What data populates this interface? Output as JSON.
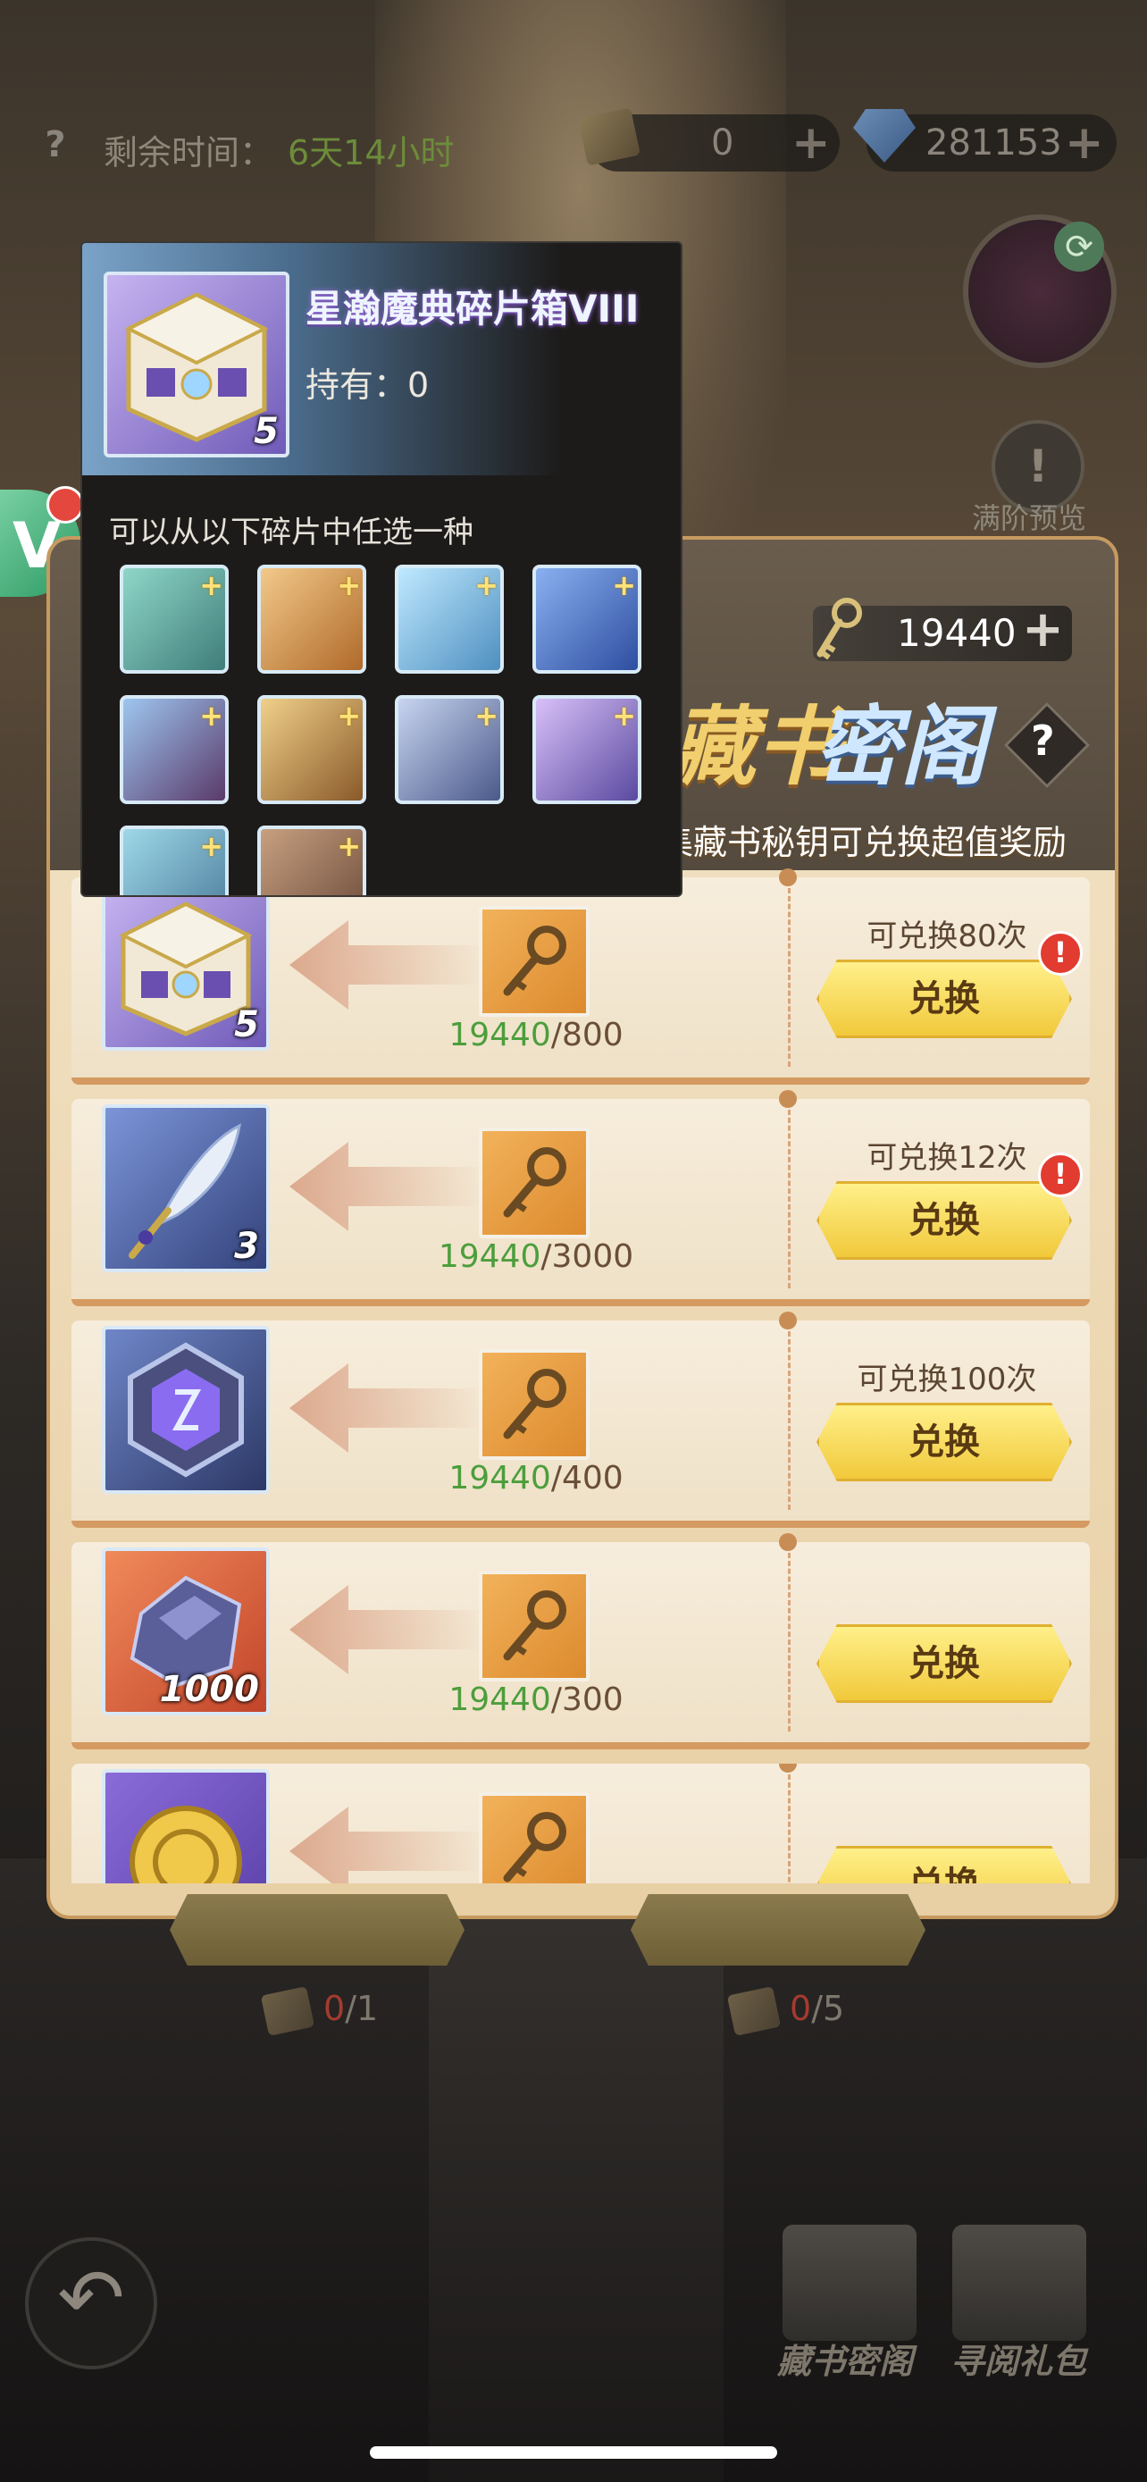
{
  "top_bar": {
    "time_label": "剩余时间：",
    "time_value": "6天14小时",
    "ticket_count": "0",
    "gem_count": "281153"
  },
  "right_side": {
    "preview_label": "满阶预览"
  },
  "panel": {
    "key_count": "19440",
    "title_part1": "藏书",
    "title_part2": "密阁",
    "subtitle": "活动期间收集藏书秘钥可兑换超值奖励"
  },
  "rows": [
    {
      "count": "5",
      "have": "19440",
      "cost": "/800",
      "limit": "可兑换80次",
      "button": "兑换",
      "alert": "!"
    },
    {
      "count": "3",
      "have": "19440",
      "cost": "/3000",
      "limit": "可兑换12次",
      "button": "兑换",
      "alert": "!"
    },
    {
      "count": "",
      "have": "19440",
      "cost": "/400",
      "limit": "可兑换100次",
      "button": "兑换"
    },
    {
      "count": "1000",
      "have": "19440",
      "cost": "/300",
      "limit": "",
      "button": "兑换"
    },
    {
      "count": "",
      "have": "",
      "cost": "",
      "limit": "",
      "button": "兑换"
    }
  ],
  "bottom": {
    "count1_have": "0",
    "count1_total": "/1",
    "count2_have": "0",
    "count2_total": "/5",
    "tab1_label": "藏书密阁",
    "tab2_label": "寻阅礼包"
  },
  "tooltip": {
    "name": "星瀚魔典碎片箱VIII",
    "own_label": "持有：0",
    "item_count": "5",
    "hint": "可以从以下碎片中任选一种"
  },
  "colors": {
    "accent_gold": "#f1c93b",
    "have_green": "#4c9e3c",
    "alert_red": "#e23b30"
  }
}
